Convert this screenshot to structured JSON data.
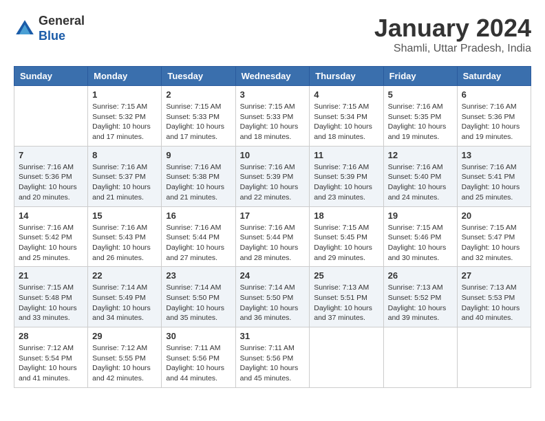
{
  "header": {
    "logo_general": "General",
    "logo_blue": "Blue",
    "month_year": "January 2024",
    "location": "Shamli, Uttar Pradesh, India"
  },
  "days_of_week": [
    "Sunday",
    "Monday",
    "Tuesday",
    "Wednesday",
    "Thursday",
    "Friday",
    "Saturday"
  ],
  "weeks": [
    [
      {
        "day": "",
        "info": ""
      },
      {
        "day": "1",
        "info": "Sunrise: 7:15 AM\nSunset: 5:32 PM\nDaylight: 10 hours\nand 17 minutes."
      },
      {
        "day": "2",
        "info": "Sunrise: 7:15 AM\nSunset: 5:33 PM\nDaylight: 10 hours\nand 17 minutes."
      },
      {
        "day": "3",
        "info": "Sunrise: 7:15 AM\nSunset: 5:33 PM\nDaylight: 10 hours\nand 18 minutes."
      },
      {
        "day": "4",
        "info": "Sunrise: 7:15 AM\nSunset: 5:34 PM\nDaylight: 10 hours\nand 18 minutes."
      },
      {
        "day": "5",
        "info": "Sunrise: 7:16 AM\nSunset: 5:35 PM\nDaylight: 10 hours\nand 19 minutes."
      },
      {
        "day": "6",
        "info": "Sunrise: 7:16 AM\nSunset: 5:36 PM\nDaylight: 10 hours\nand 19 minutes."
      }
    ],
    [
      {
        "day": "7",
        "info": "Sunrise: 7:16 AM\nSunset: 5:36 PM\nDaylight: 10 hours\nand 20 minutes."
      },
      {
        "day": "8",
        "info": "Sunrise: 7:16 AM\nSunset: 5:37 PM\nDaylight: 10 hours\nand 21 minutes."
      },
      {
        "day": "9",
        "info": "Sunrise: 7:16 AM\nSunset: 5:38 PM\nDaylight: 10 hours\nand 21 minutes."
      },
      {
        "day": "10",
        "info": "Sunrise: 7:16 AM\nSunset: 5:39 PM\nDaylight: 10 hours\nand 22 minutes."
      },
      {
        "day": "11",
        "info": "Sunrise: 7:16 AM\nSunset: 5:39 PM\nDaylight: 10 hours\nand 23 minutes."
      },
      {
        "day": "12",
        "info": "Sunrise: 7:16 AM\nSunset: 5:40 PM\nDaylight: 10 hours\nand 24 minutes."
      },
      {
        "day": "13",
        "info": "Sunrise: 7:16 AM\nSunset: 5:41 PM\nDaylight: 10 hours\nand 25 minutes."
      }
    ],
    [
      {
        "day": "14",
        "info": "Sunrise: 7:16 AM\nSunset: 5:42 PM\nDaylight: 10 hours\nand 25 minutes."
      },
      {
        "day": "15",
        "info": "Sunrise: 7:16 AM\nSunset: 5:43 PM\nDaylight: 10 hours\nand 26 minutes."
      },
      {
        "day": "16",
        "info": "Sunrise: 7:16 AM\nSunset: 5:44 PM\nDaylight: 10 hours\nand 27 minutes."
      },
      {
        "day": "17",
        "info": "Sunrise: 7:16 AM\nSunset: 5:44 PM\nDaylight: 10 hours\nand 28 minutes."
      },
      {
        "day": "18",
        "info": "Sunrise: 7:15 AM\nSunset: 5:45 PM\nDaylight: 10 hours\nand 29 minutes."
      },
      {
        "day": "19",
        "info": "Sunrise: 7:15 AM\nSunset: 5:46 PM\nDaylight: 10 hours\nand 30 minutes."
      },
      {
        "day": "20",
        "info": "Sunrise: 7:15 AM\nSunset: 5:47 PM\nDaylight: 10 hours\nand 32 minutes."
      }
    ],
    [
      {
        "day": "21",
        "info": "Sunrise: 7:15 AM\nSunset: 5:48 PM\nDaylight: 10 hours\nand 33 minutes."
      },
      {
        "day": "22",
        "info": "Sunrise: 7:14 AM\nSunset: 5:49 PM\nDaylight: 10 hours\nand 34 minutes."
      },
      {
        "day": "23",
        "info": "Sunrise: 7:14 AM\nSunset: 5:50 PM\nDaylight: 10 hours\nand 35 minutes."
      },
      {
        "day": "24",
        "info": "Sunrise: 7:14 AM\nSunset: 5:50 PM\nDaylight: 10 hours\nand 36 minutes."
      },
      {
        "day": "25",
        "info": "Sunrise: 7:13 AM\nSunset: 5:51 PM\nDaylight: 10 hours\nand 37 minutes."
      },
      {
        "day": "26",
        "info": "Sunrise: 7:13 AM\nSunset: 5:52 PM\nDaylight: 10 hours\nand 39 minutes."
      },
      {
        "day": "27",
        "info": "Sunrise: 7:13 AM\nSunset: 5:53 PM\nDaylight: 10 hours\nand 40 minutes."
      }
    ],
    [
      {
        "day": "28",
        "info": "Sunrise: 7:12 AM\nSunset: 5:54 PM\nDaylight: 10 hours\nand 41 minutes."
      },
      {
        "day": "29",
        "info": "Sunrise: 7:12 AM\nSunset: 5:55 PM\nDaylight: 10 hours\nand 42 minutes."
      },
      {
        "day": "30",
        "info": "Sunrise: 7:11 AM\nSunset: 5:56 PM\nDaylight: 10 hours\nand 44 minutes."
      },
      {
        "day": "31",
        "info": "Sunrise: 7:11 AM\nSunset: 5:56 PM\nDaylight: 10 hours\nand 45 minutes."
      },
      {
        "day": "",
        "info": ""
      },
      {
        "day": "",
        "info": ""
      },
      {
        "day": "",
        "info": ""
      }
    ]
  ]
}
